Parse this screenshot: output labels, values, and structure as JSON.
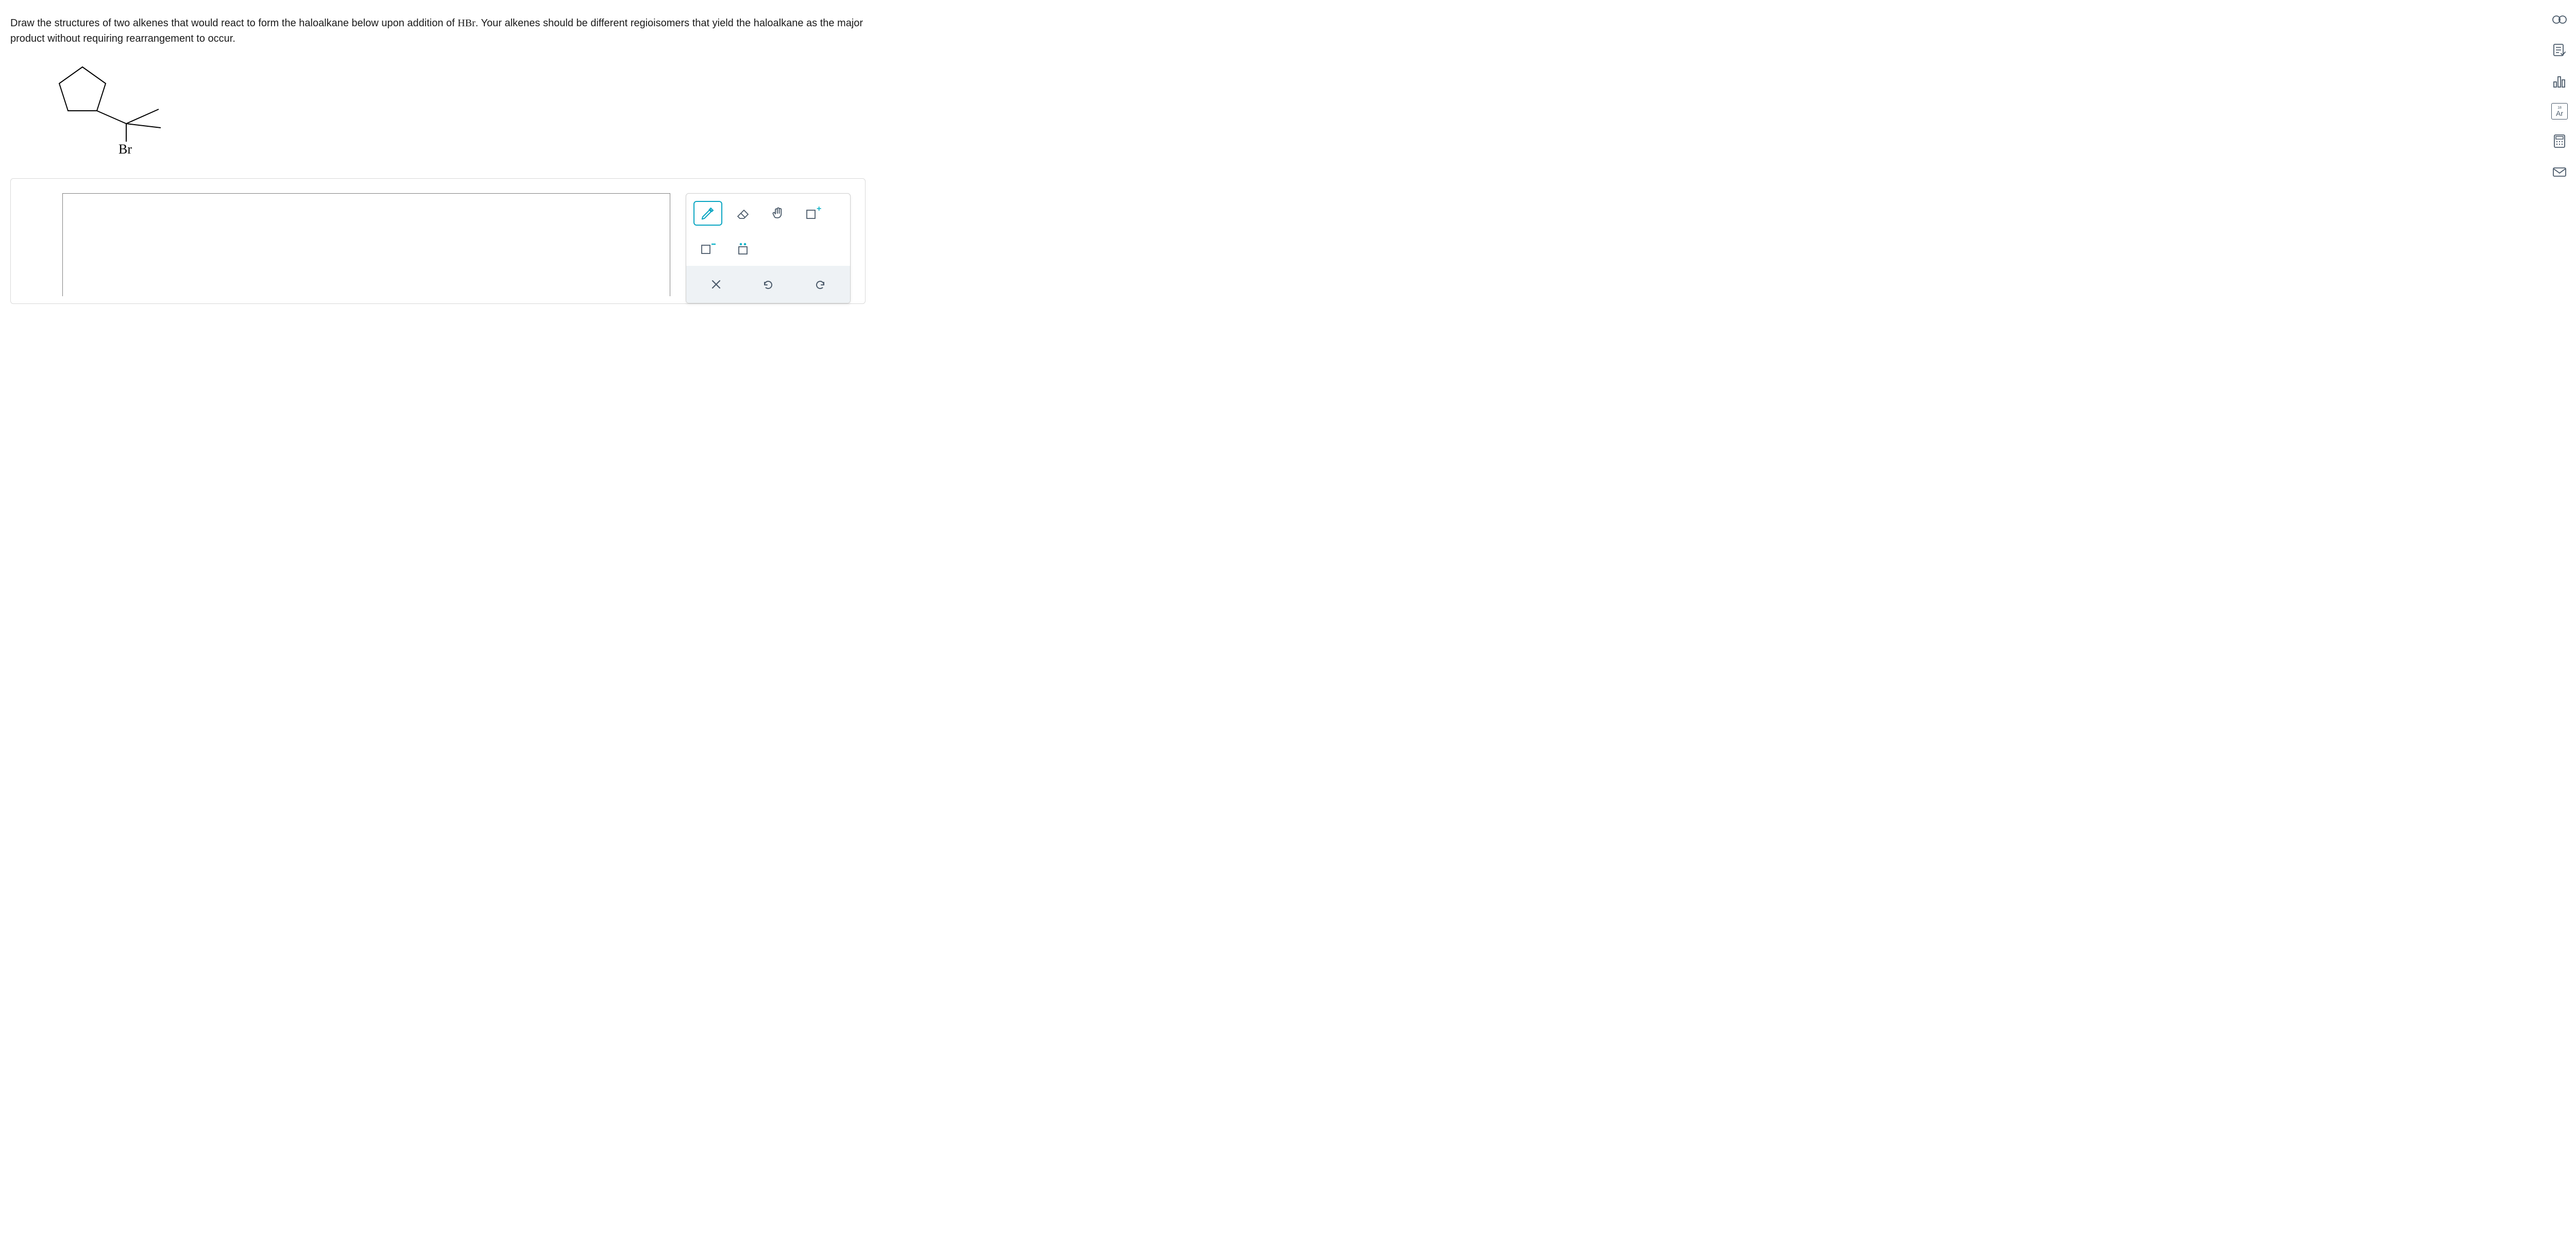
{
  "question": {
    "text_before_formula": "Draw the structures of two alkenes that would react to form the haloalkane below upon addition of ",
    "formula": "HBr",
    "text_after_formula": ". Your alkenes should be different regioisomers that yield the haloalkane as the major product without requiring rearrangement to occur."
  },
  "molecule_label": "Br",
  "tools": {
    "pencil": "pencil-icon",
    "eraser": "eraser-icon",
    "move": "hand-icon",
    "add_box": "add-box-icon",
    "negative_charge": "negative-charge-icon",
    "lone_pair": "lone-pair-icon",
    "clear": "clear-icon",
    "undo": "undo-icon",
    "redo": "redo-icon"
  },
  "rail": {
    "view": "view-icon",
    "checklist": "checklist-icon",
    "stats": "bar-chart-icon",
    "periodic": "Ar",
    "periodic_num": "18",
    "calculator": "calculator-icon",
    "mail": "mail-icon"
  },
  "colors": {
    "accent": "#0aa6c2",
    "icon": "#4b5a6a",
    "plus": "#13b5c9"
  }
}
